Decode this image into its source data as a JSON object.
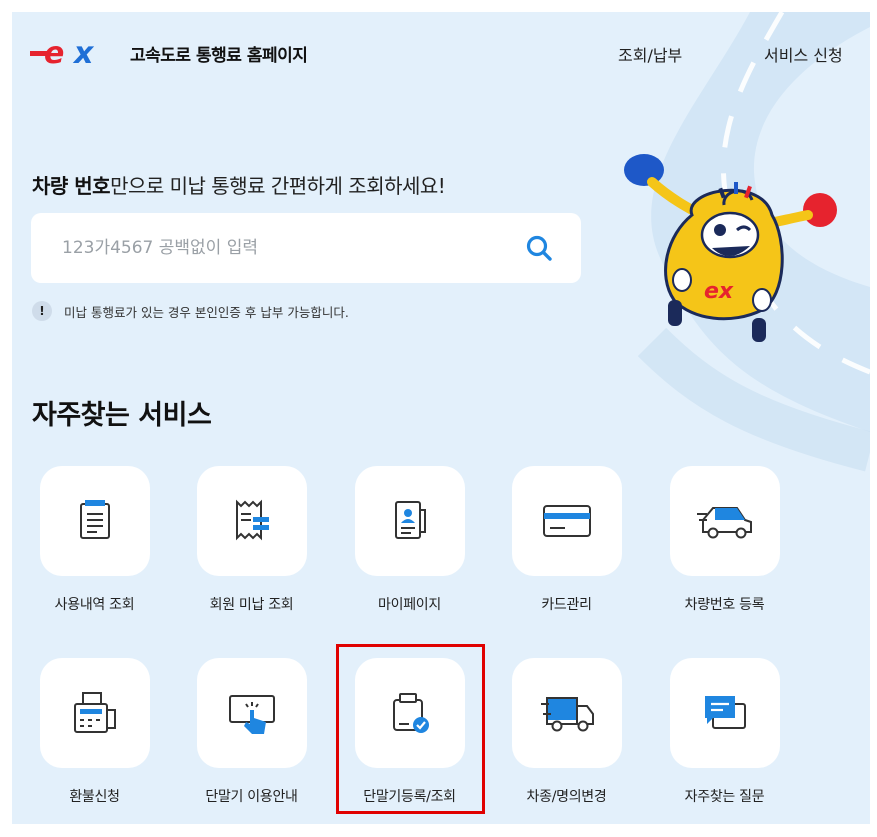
{
  "header": {
    "site_title": "고속도로 통행료 홈페이지",
    "nav": [
      "조회/납부",
      "서비스 신청"
    ],
    "logo_text": "ex"
  },
  "search": {
    "headline_bold": "차량 번호",
    "headline_rest": "만으로 미납 통행료 간편하게 조회하세요!",
    "placeholder": "123가4567 공백없이 입력",
    "notice_icon": "!",
    "notice": "미납 통행료가 있는 경우 본인인증 후 납부 가능합니다."
  },
  "services": {
    "title": "자주찾는 서비스",
    "items": [
      {
        "label": "사용내역 조회",
        "icon": "document-list-icon"
      },
      {
        "label": "회원 미납 조회",
        "icon": "receipt-icon"
      },
      {
        "label": "마이페이지",
        "icon": "profile-card-icon"
      },
      {
        "label": "카드관리",
        "icon": "credit-card-icon"
      },
      {
        "label": "차량번호 등록",
        "icon": "car-icon"
      },
      {
        "label": "환불신청",
        "icon": "printer-icon"
      },
      {
        "label": "단말기 이용안내",
        "icon": "touch-hand-icon"
      },
      {
        "label": "단말기등록/조회",
        "icon": "device-check-icon"
      },
      {
        "label": "차종/명의변경",
        "icon": "truck-icon"
      },
      {
        "label": "자주찾는 질문",
        "icon": "chat-bubble-icon"
      }
    ]
  },
  "colors": {
    "brand_red": "#e6232e",
    "brand_blue": "#1f6fd6",
    "accent_blue": "#1f86e0",
    "background": "#e3f0fb",
    "highlight": "#e00000",
    "mascot_yellow": "#f5c518"
  }
}
